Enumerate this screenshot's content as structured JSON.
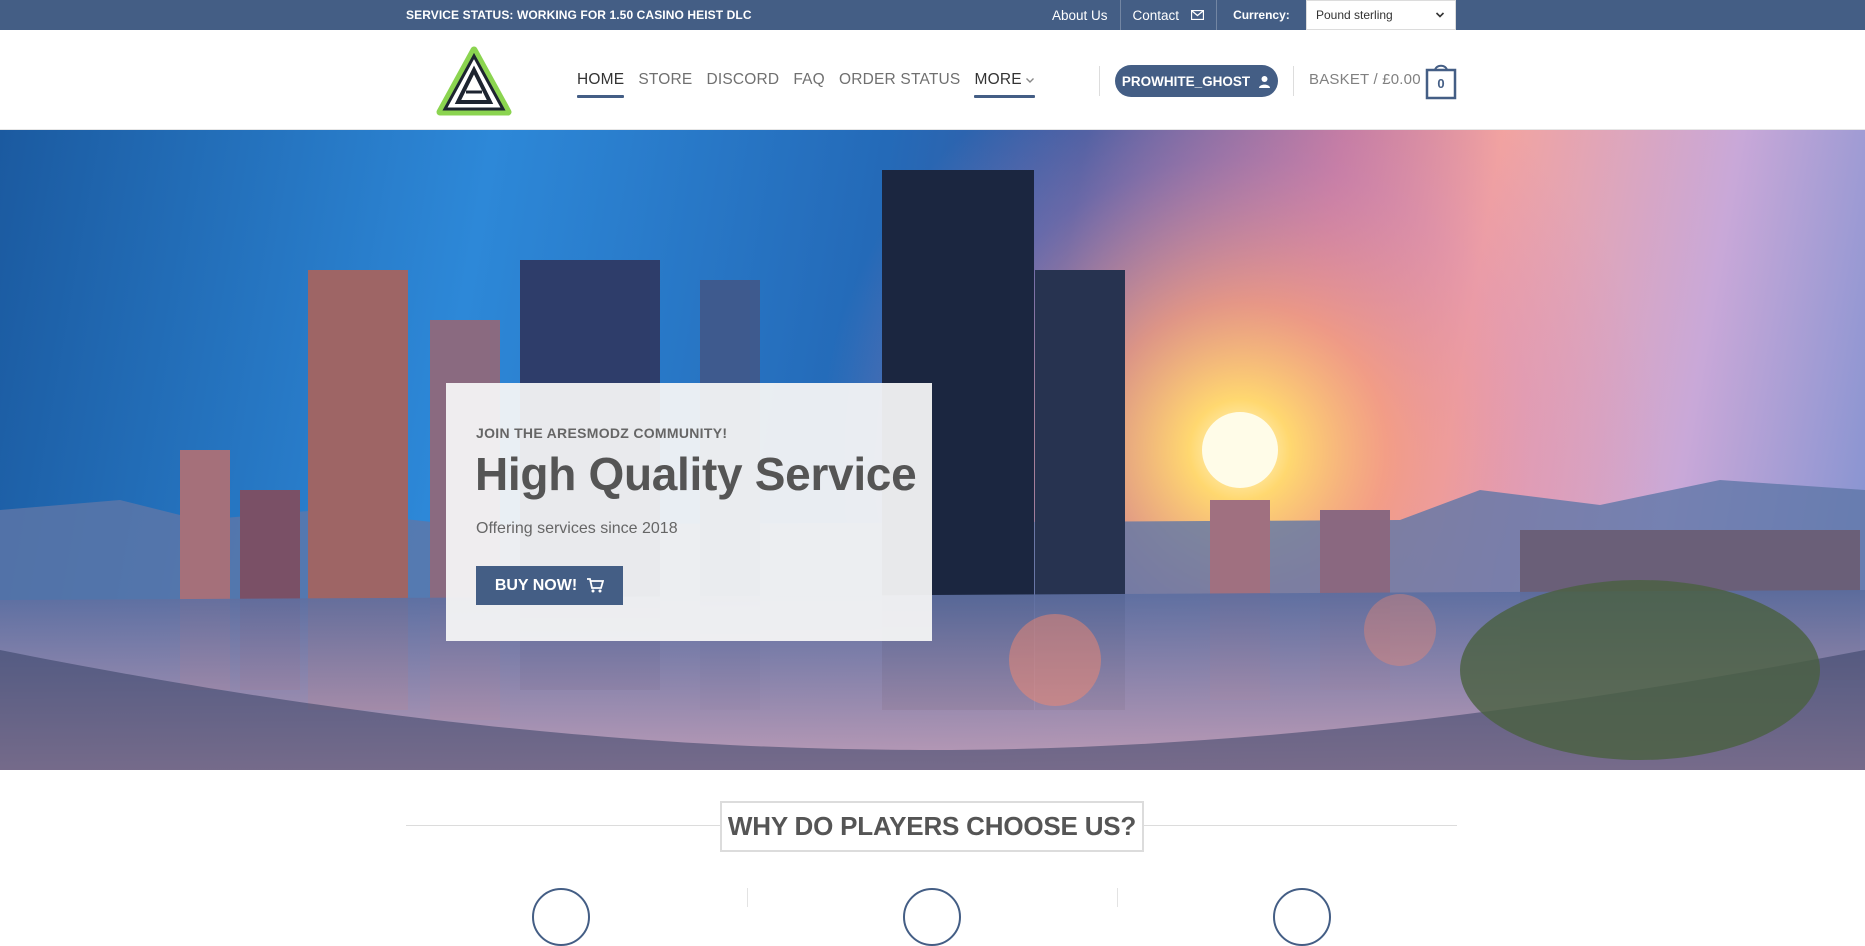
{
  "topbar": {
    "status_text": "SERVICE STATUS: WORKING FOR 1.50 CASINO HEIST DLC",
    "links": {
      "about": "About Us",
      "contact": "Contact"
    },
    "currency_label": "Currency:",
    "currency_selected": "Pound sterling"
  },
  "header": {
    "nav": [
      {
        "label": "HOME"
      },
      {
        "label": "STORE"
      },
      {
        "label": "DISCORD"
      },
      {
        "label": "FAQ"
      },
      {
        "label": "ORDER STATUS"
      },
      {
        "label": "MORE"
      }
    ],
    "account_label": "PROWHITE_GHOST",
    "basket_label": "BASKET / £0.00",
    "basket_count": "0"
  },
  "hero": {
    "kicker": "JOIN THE ARESMODZ COMMUNITY!",
    "title": "High Quality Service",
    "subtitle": "Offering services since 2018",
    "button_label": "BUY NOW!"
  },
  "why": {
    "heading": "WHY DO PLAYERS CHOOSE US?"
  },
  "colors": {
    "brand": "#445e85",
    "logo_green": "#8bd450"
  }
}
